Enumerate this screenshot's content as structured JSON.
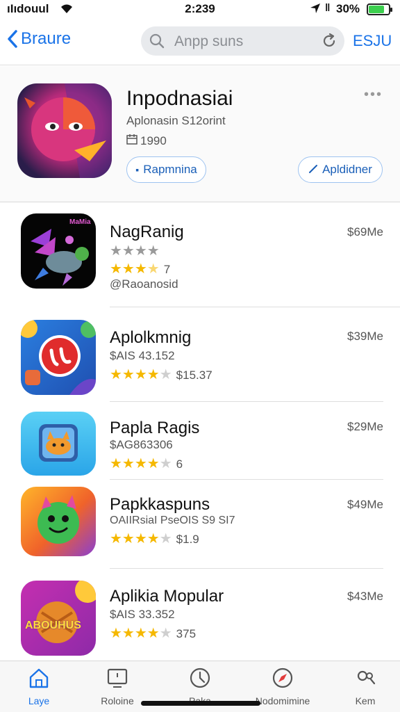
{
  "status_bar": {
    "carrier": "ıIıdouul",
    "time": "2:239",
    "alarm": "ǁ",
    "battery_pct": "30%",
    "battery_level": 0.8,
    "battery_color": "#3ccf4e"
  },
  "nav": {
    "back_label": "Braure",
    "search_placeholder": "Anpp suns",
    "right_label": "ESJU"
  },
  "featured": {
    "title": "Inpodnasiai",
    "subtitle": "Aplonasin S12orint",
    "meta": "1990",
    "left_button": "Rapmnina",
    "right_button": "Apldidner",
    "more": "•••"
  },
  "apps": [
    {
      "name": "NagRanig",
      "price": "$69Me",
      "grey_stars": 4,
      "stars_on": 3,
      "stars_half": 1,
      "stars_off": 0,
      "rating_note": "7",
      "sub": "@Raoanosid"
    },
    {
      "name": "Aplolkmnig",
      "price": "$39Me",
      "sub": "$AIS 43.152",
      "stars_on": 4,
      "stars_off": 1,
      "rating_note": "$15.37"
    },
    {
      "name": "Papla Ragis",
      "price": "$29Me",
      "sub": "$AG863306",
      "stars_on": 4,
      "stars_off": 1,
      "rating_note": "6"
    },
    {
      "name": "Papkkaspuns",
      "price": "$49Me",
      "sub": "OAIIRsiaI PseOIS S9 SI7",
      "stars_on": 4,
      "stars_off": 1,
      "rating_note": "$1.9"
    },
    {
      "name": "Aplikia Mopular",
      "price": "$43Me",
      "sub": "$AIS 33.352",
      "stars_on": 4,
      "stars_off": 1,
      "rating_note": "375",
      "icon_text": "ABOUHUS"
    }
  ],
  "featured_icon_label": "MaMia",
  "tabs": [
    {
      "label": "Laye",
      "icon": "home-icon",
      "active": true
    },
    {
      "label": "Roloine",
      "icon": "screen-icon",
      "active": false
    },
    {
      "label": "Paka",
      "icon": "clock-icon",
      "active": false
    },
    {
      "label": "Nodomimine",
      "icon": "compass-icon",
      "active": false
    },
    {
      "label": "Kem",
      "icon": "search-icon",
      "active": false
    }
  ],
  "colors": {
    "accent": "#1a73e8",
    "star": "#f5b800"
  }
}
